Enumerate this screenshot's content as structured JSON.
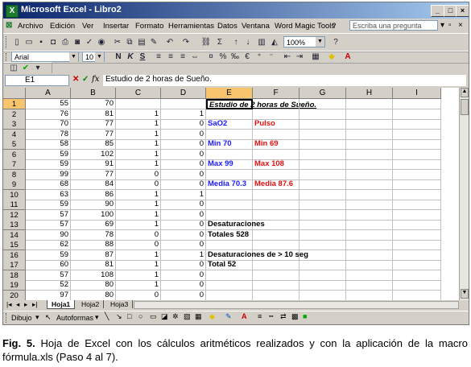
{
  "window": {
    "title": "Microsoft Excel - Libro2"
  },
  "menu": {
    "items": [
      "Archivo",
      "Edición",
      "Ver",
      "Insertar",
      "Formato",
      "Herramientas",
      "Datos",
      "Ventana",
      "Word Magic Tools",
      "?"
    ],
    "ask_placeholder": "Escriba una pregunta"
  },
  "toolbar": {
    "zoom": "100%",
    "font": "Arial",
    "size": "10"
  },
  "formula": {
    "name_box": "E1",
    "fx": "fx",
    "content": "Estudio de 2 horas de Sueño."
  },
  "grid": {
    "columns": [
      "A",
      "B",
      "C",
      "D",
      "E",
      "F",
      "G",
      "H",
      "I"
    ],
    "rows": [
      {
        "n": "1",
        "A": "55",
        "B": "70",
        "C": "",
        "D": "",
        "E": "Estudio de 2 horas de Sueño.",
        "F": ""
      },
      {
        "n": "2",
        "A": "76",
        "B": "81",
        "C": "1",
        "D": "1",
        "E": "",
        "F": ""
      },
      {
        "n": "3",
        "A": "70",
        "B": "77",
        "C": "1",
        "D": "0",
        "E": "SaO2",
        "F": "Pulso"
      },
      {
        "n": "4",
        "A": "78",
        "B": "77",
        "C": "1",
        "D": "0",
        "E": "",
        "F": ""
      },
      {
        "n": "5",
        "A": "58",
        "B": "85",
        "C": "1",
        "D": "0",
        "E": "Min   70",
        "F": "Min   69"
      },
      {
        "n": "6",
        "A": "59",
        "B": "102",
        "C": "1",
        "D": "0",
        "E": "",
        "F": ""
      },
      {
        "n": "7",
        "A": "59",
        "B": "91",
        "C": "1",
        "D": "0",
        "E": "Max   99",
        "F": "Max   108"
      },
      {
        "n": "8",
        "A": "99",
        "B": "77",
        "C": "0",
        "D": "0",
        "E": "",
        "F": ""
      },
      {
        "n": "9",
        "A": "68",
        "B": "84",
        "C": "0",
        "D": "0",
        "E": "Media  70.3",
        "F": "Media   87.6"
      },
      {
        "n": "10",
        "A": "63",
        "B": "86",
        "C": "1",
        "D": "1",
        "E": "",
        "F": ""
      },
      {
        "n": "11",
        "A": "59",
        "B": "90",
        "C": "1",
        "D": "0",
        "E": "",
        "F": ""
      },
      {
        "n": "12",
        "A": "57",
        "B": "100",
        "C": "1",
        "D": "0",
        "E": "",
        "F": ""
      },
      {
        "n": "13",
        "A": "57",
        "B": "69",
        "C": "1",
        "D": "0",
        "E": "Desaturaciones",
        "F": ""
      },
      {
        "n": "14",
        "A": "90",
        "B": "78",
        "C": "0",
        "D": "0",
        "E": "Totales  528",
        "F": ""
      },
      {
        "n": "15",
        "A": "62",
        "B": "88",
        "C": "0",
        "D": "0",
        "E": "",
        "F": ""
      },
      {
        "n": "16",
        "A": "59",
        "B": "87",
        "C": "1",
        "D": "1",
        "E": "Desaturaciones de > 10 seg",
        "F": ""
      },
      {
        "n": "17",
        "A": "60",
        "B": "81",
        "C": "1",
        "D": "0",
        "E": "Total  52",
        "F": ""
      },
      {
        "n": "18",
        "A": "57",
        "B": "108",
        "C": "1",
        "D": "0",
        "E": "",
        "F": ""
      },
      {
        "n": "19",
        "A": "52",
        "B": "80",
        "C": "1",
        "D": "0",
        "E": "",
        "F": ""
      },
      {
        "n": "20",
        "A": "97",
        "B": "80",
        "C": "0",
        "D": "0",
        "E": "",
        "F": ""
      }
    ]
  },
  "sheets": [
    "Hoja1",
    "Hoja2",
    "Hoja3"
  ],
  "drawing": {
    "dibujo": "Dibujo",
    "autoformas": "Autoformas"
  },
  "caption": {
    "label": "Fig. 5.",
    "text": " Hoja de Excel con los cálculos aritméticos realizados y con la aplicación de la macro fórmula.xls (Paso 4 al 7)."
  },
  "colors": {
    "blue_text": "#1a1aff",
    "red_text": "#e01010",
    "title_bar": "#0a246a",
    "selected_header": "#f8c46e"
  }
}
